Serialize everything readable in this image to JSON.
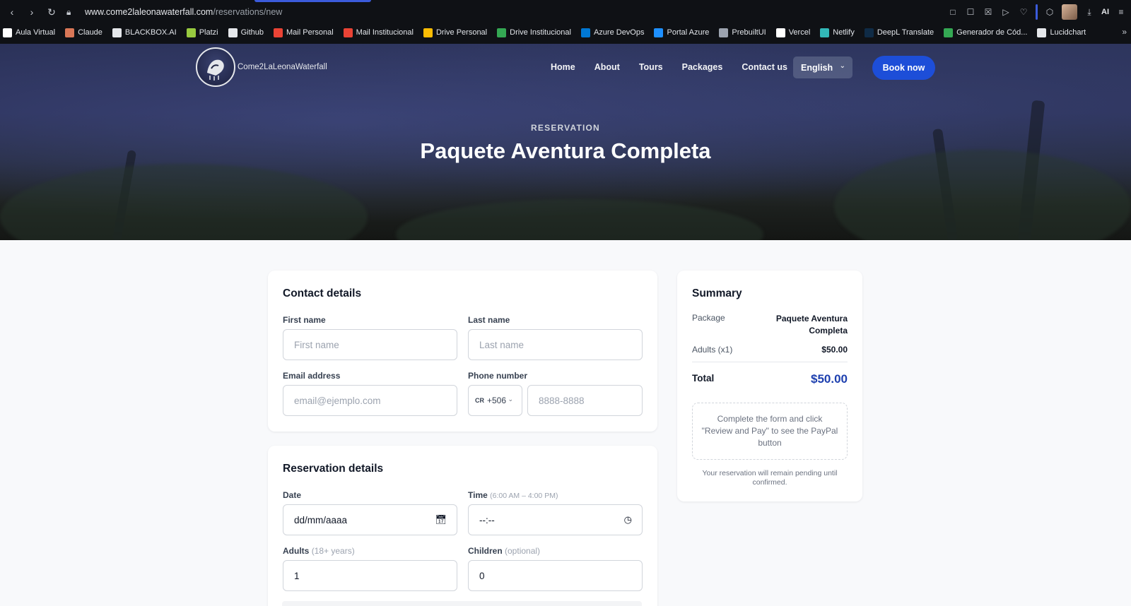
{
  "browser": {
    "url_host": "www.come2laleonawaterfall.com",
    "url_path": "/reservations/new",
    "ai_label": "AI",
    "bookmarks": [
      {
        "label": "Aula Virtual",
        "color": "#ffffff"
      },
      {
        "label": "Claude",
        "color": "#d97757"
      },
      {
        "label": "BLACKBOX.AI",
        "color": "#e5e7eb"
      },
      {
        "label": "Platzi",
        "color": "#98ca3f"
      },
      {
        "label": "Github",
        "color": "#e5e7eb"
      },
      {
        "label": "Mail Personal",
        "color": "#ea4335"
      },
      {
        "label": "Mail Institucional",
        "color": "#ea4335"
      },
      {
        "label": "Drive Personal",
        "color": "#fbbc04"
      },
      {
        "label": "Drive Institucional",
        "color": "#34a853"
      },
      {
        "label": "Azure DevOps",
        "color": "#0078d4"
      },
      {
        "label": "Portal Azure",
        "color": "#1e90ff"
      },
      {
        "label": "PrebuiltUI",
        "color": "#9ca3af"
      },
      {
        "label": "Vercel",
        "color": "#ffffff"
      },
      {
        "label": "Netlify",
        "color": "#32b8b8"
      },
      {
        "label": "DeepL Translate",
        "color": "#0f2b46"
      },
      {
        "label": "Generador de Cód...",
        "color": "#34a853"
      },
      {
        "label": "Lucidchart",
        "color": "#e5e7eb"
      }
    ],
    "overflow": "»"
  },
  "site": {
    "brand": "Come2LaLeonaWaterfall",
    "menu": [
      "Home",
      "About",
      "Tours",
      "Packages",
      "Contact us"
    ],
    "language": "English",
    "book_label": "Book now"
  },
  "hero": {
    "kicker": "RESERVATION",
    "title": "Paquete Aventura Completa"
  },
  "contact": {
    "title": "Contact details",
    "first_name_label": "First name",
    "first_name_placeholder": "First name",
    "last_name_label": "Last name",
    "last_name_placeholder": "Last name",
    "email_label": "Email address",
    "email_placeholder": "email@ejemplo.com",
    "phone_label": "Phone number",
    "country_flag": "CR",
    "country_code": "+506",
    "phone_placeholder": "8888-8888"
  },
  "reservation": {
    "title": "Reservation details",
    "date_label": "Date",
    "date_value": "dd/mm/aaaa",
    "time_label": "Time",
    "time_hint": "(6:00 AM – 4:00 PM)",
    "time_value": "--:--",
    "adults_label": "Adults",
    "adults_hint": "(18+ years)",
    "adults_value": "1",
    "children_label": "Children",
    "children_hint": "(optional)",
    "children_value": "0"
  },
  "summary": {
    "title": "Summary",
    "package_label": "Package",
    "package_value": "Paquete Aventura Completa",
    "adults_label": "Adults (x1)",
    "adults_value": "$50.00",
    "total_label": "Total",
    "total_value": "$50.00",
    "notice": "Complete the form and click \"Review and Pay\" to see the PayPal button",
    "pending": "Your reservation will remain pending until confirmed."
  }
}
